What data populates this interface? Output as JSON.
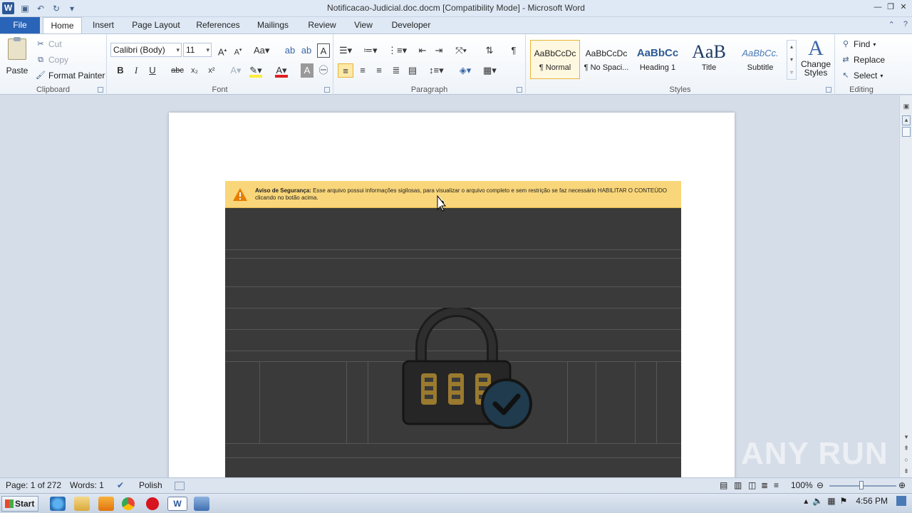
{
  "window": {
    "title": "Notificacao-Judicial.doc.docm [Compatibility Mode] - Microsoft Word",
    "app_icon": "W"
  },
  "tabs": [
    "File",
    "Home",
    "Insert",
    "Page Layout",
    "References",
    "Mailings",
    "Review",
    "View",
    "Developer"
  ],
  "active_tab": "Home",
  "ribbon": {
    "clipboard": {
      "label": "Clipboard",
      "paste": "Paste",
      "cut": "Cut",
      "copy": "Copy",
      "format_painter": "Format Painter"
    },
    "font": {
      "label": "Font",
      "name": "Calibri (Body)",
      "size": "11"
    },
    "paragraph": {
      "label": "Paragraph"
    },
    "styles": {
      "label": "Styles",
      "items": [
        {
          "sample": "AaBbCcDc",
          "name": "¶ Normal"
        },
        {
          "sample": "AaBbCcDc",
          "name": "¶ No Spaci..."
        },
        {
          "sample": "AaBbCc",
          "name": "Heading 1"
        },
        {
          "sample": "AaB",
          "name": "Title"
        },
        {
          "sample": "AaBbCc.",
          "name": "Subtitle"
        }
      ],
      "change_styles": "Change Styles"
    },
    "editing": {
      "label": "Editing",
      "find": "Find",
      "replace": "Replace",
      "select": "Select"
    }
  },
  "document": {
    "banner_title": "Aviso de Segurança:",
    "banner_text": "Esse arquivo possui informações sigilosas, para visualizar o arquivo completo e sem restrição se faz necessário HABILITAR O CONTEÚDO clicando no botão acima."
  },
  "watermark": "ANY RUN",
  "statusbar": {
    "page": "Page: 1 of 272",
    "words": "Words: 1",
    "language": "Polish",
    "zoom": "100%",
    "zoom_level": 100
  },
  "taskbar": {
    "start": "Start",
    "clock": "4:56 PM"
  },
  "colors": {
    "file_tab": "#2a64b8",
    "banner": "#f9d67a",
    "lock_dark": "#2a2a2a",
    "lock_accent": "#e3b94f",
    "check_badge": "#1f3b4d"
  }
}
